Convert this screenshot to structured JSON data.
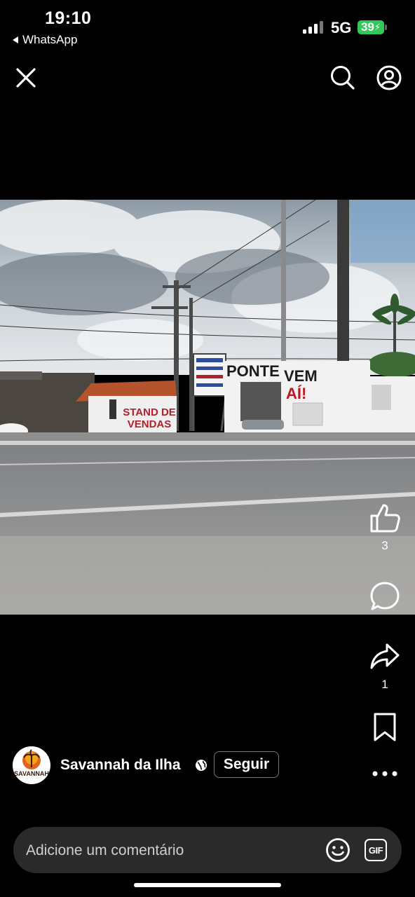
{
  "status_bar": {
    "time": "19:10",
    "back_app": "WhatsApp",
    "network": "5G",
    "battery": "39"
  },
  "top_bar": {
    "close_icon": "close-icon",
    "search_icon": "search-icon",
    "profile_icon": "profile-icon"
  },
  "video": {
    "signs": {
      "stand_line1": "STAND DE",
      "stand_line2": "VENDAS",
      "ponte_left": "PONTE",
      "ponte_right": "VEM",
      "ai": "AÍ!"
    }
  },
  "actions": {
    "like_count": "3",
    "share_count": "1"
  },
  "author": {
    "name": "Savannah da Ilha",
    "follow_label": "Seguir",
    "avatar_text": "SAVANNAH"
  },
  "comment": {
    "placeholder": "Adicione um comentário",
    "gif_label": "GIF"
  },
  "colors": {
    "background": "#000000",
    "battery": "#34c759",
    "comment_bar": "#2a2a2a"
  }
}
